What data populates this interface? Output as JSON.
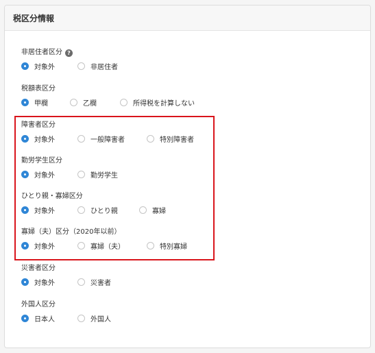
{
  "panel": {
    "title": "税区分情報"
  },
  "groups": [
    {
      "id": "non-resident",
      "label": "非居住者区分",
      "help_icon": "question-circle-icon",
      "options": [
        "対象外",
        "非居住者"
      ],
      "selected": 0
    },
    {
      "id": "tax-table",
      "label": "税額表区分",
      "options": [
        "甲欄",
        "乙欄",
        "所得税を計算しない"
      ],
      "selected": 0
    },
    {
      "id": "disability",
      "label": "障害者区分",
      "options": [
        "対象外",
        "一般障害者",
        "特別障害者"
      ],
      "selected": 0
    },
    {
      "id": "working-student",
      "label": "勤労学生区分",
      "options": [
        "対象外",
        "勤労学生"
      ],
      "selected": 0
    },
    {
      "id": "single-parent-widow",
      "label": "ひとり親・寡婦区分",
      "options": [
        "対象外",
        "ひとり親",
        "寡婦"
      ],
      "selected": 0
    },
    {
      "id": "widow-husband-2020",
      "label": "寡婦（夫）区分（2020年以前）",
      "options": [
        "対象外",
        "寡婦（夫）",
        "特別寡婦"
      ],
      "selected": 0
    },
    {
      "id": "disaster-victim",
      "label": "災害者区分",
      "options": [
        "対象外",
        "災害者"
      ],
      "selected": 0
    },
    {
      "id": "foreigner",
      "label": "外国人区分",
      "options": [
        "日本人",
        "外国人"
      ],
      "selected": 0
    }
  ],
  "colors": {
    "accent": "#2f86d6",
    "highlight_border": "#d9141b"
  }
}
